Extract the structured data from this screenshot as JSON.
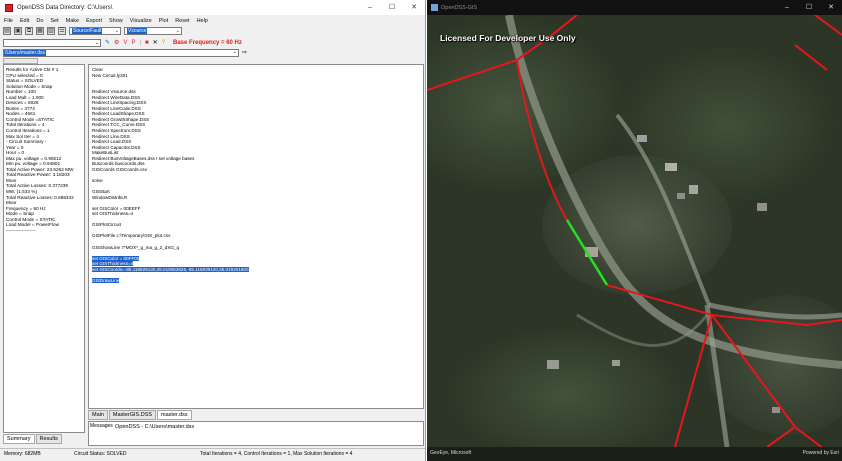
{
  "odss": {
    "title": "OpenDSS Data Directory: C:\\Users\\",
    "window_buttons": [
      "–",
      "☐",
      "✕"
    ],
    "menu": [
      "File",
      "Edit",
      "Do",
      "Set",
      "Make",
      "Export",
      "Show",
      "Visualize",
      "Plot",
      "Reset",
      "Help"
    ],
    "toolbar": {
      "class_select": "Source/Fault",
      "element_select": "Vsource",
      "base_frequency": "Base Frequency = 60 Hz"
    },
    "file_path": "/Users/master.dss",
    "summary_lines": [
      "Results for Active Ckt # 1",
      "CPU selected = 0",
      "Status = SOLVED",
      "Solution Mode = Snap",
      "Number = 100",
      "Load Mult = 1.000",
      "Devices = 6026",
      "Buses = 3774",
      "Nodes = 4661",
      "Control Mode =STATIC",
      "Total Iterations = 4",
      "Control Iterations = 1",
      "Max Sol Iter = 4",
      "",
      " - Circuit Summary -",
      "",
      "Year = 0",
      "Hour = 0",
      "Max pu. voltage = 0.99212",
      "Min pu. voltage = 0.94801",
      "Total Active Power:   23.6262 MW",
      "Total Reactive Power:  3.18203",
      "Mvar",
      "Total Active Losses:  0.377239",
      "MW, (1.533 %)",
      "Total Reactive Losses: 0.688332",
      "Mvar",
      "Frequency = 60 Hz",
      "Mode = Snap",
      "Control Mode = STATIC",
      "Load Model = PowerFlow",
      "-------------------"
    ],
    "script_lines": [
      "Clear",
      "New Circuit.ly201",
      "",
      "",
      "Redirect Vsource.dss",
      "Redirect WireData.DSS",
      "Redirect LineSpacing.DSS",
      "Redirect LineCode.DSS",
      "Redirect LoadShape.DSS",
      "Redirect GrowthShape.DSS",
      "Redirect TCC_Curve.DSS",
      "Redirect Spectrum.DSS",
      "Redirect Line.DSS",
      "Redirect Load.DSS",
      "Redirect Capacitor.DSS",
      "MakeBusList",
      "Redirect BusVoltageBases.dss  ! set voltage bases",
      "Buscoords buscoords.dss",
      "GISCoords GISCoords.csv",
      "",
      "solve",
      "",
      "GISStart",
      "WindowDistribLR",
      "",
      "set GISColor = 00EEFF",
      "set GISThickness=4",
      "",
      "GISPlotCircuit",
      "",
      "GISPlotFile c:\\Temporary\\GIS_plot.csv",
      "",
      "GISShowLine 7*MOX*_g_ma_g_2_dXG_q",
      "",
      "set GISColor = 00FF00",
      "set GISThickness=4",
      "set GISCoords=-85.115829130,35.019063625,-85.115839120,35.019201820",
      "",
      "GISDrawLine"
    ],
    "bottom_tabs": [
      "Main",
      "MasterGIS.DSS",
      "master.dss"
    ],
    "messages_label": "Messages",
    "message_text": "OpenDSS - C:\\Users\\master.dss",
    "left_tabs": [
      "Summary",
      "Results"
    ],
    "status": {
      "memory": "Memory: 682MB",
      "circuit": "Circuit Status: SOLVED",
      "iterations": "Total Iterations = 4, Control Iterations = 1, Max Solution Iterations = 4"
    }
  },
  "map": {
    "title": "OpenDSS-GIS",
    "window_buttons": [
      "–",
      "☐",
      "✕"
    ],
    "license_text": "Licensed For Developer Use Only",
    "attribution_left": "GeoEye, Microsoft",
    "attribution_right": "Powered by Esri",
    "colors": {
      "lines": "#e8161b",
      "highlight": "#27e020"
    }
  }
}
